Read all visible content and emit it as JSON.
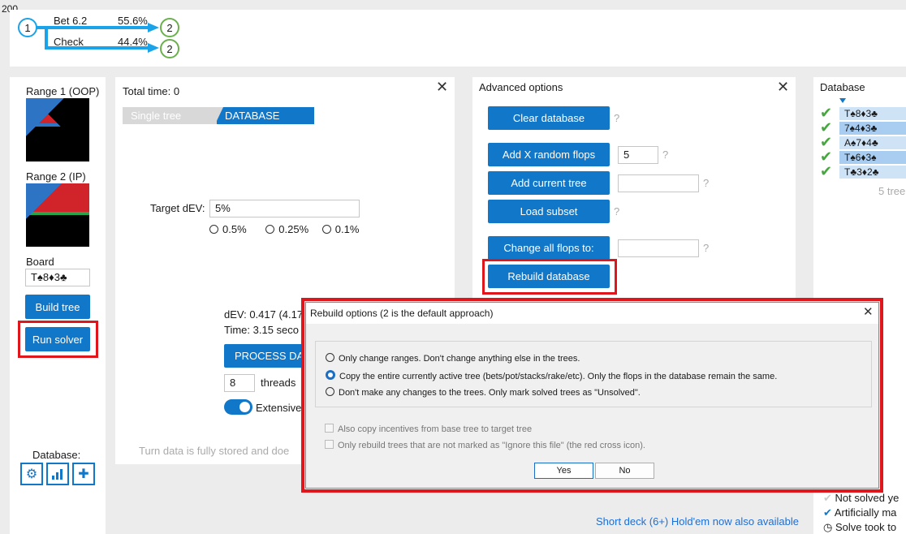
{
  "corner_label": "200",
  "tree": {
    "root_node": "1",
    "branches": [
      {
        "action": "Bet 6.2",
        "freq": "55.6%",
        "node": "2"
      },
      {
        "action": "Check",
        "freq": "44.4%",
        "node": "2"
      }
    ]
  },
  "left_panel": {
    "range1_label": "Range 1 (OOP)",
    "range2_label": "Range 2 (IP)",
    "board_label": "Board",
    "board_value": "T♠8♦3♣",
    "build_tree": "Build tree",
    "run_solver": "Run solver",
    "database_label": "Database:",
    "icons": [
      "gear-icon",
      "bar-chart-icon",
      "plus-icon"
    ]
  },
  "middle_panel": {
    "total_time": "Total time: 0",
    "tabs": [
      "Single tree",
      "DATABASE"
    ],
    "target_dev_label": "Target dEV:",
    "target_dev_value": "5%",
    "radio_options": [
      "0.5%",
      "0.25%",
      "0.1%"
    ],
    "dev_result": "dEV: 0.417 (4.17",
    "time_result": "Time: 3.15 seco",
    "process_button": "PROCESS DAT",
    "threads_value": "8",
    "threads_label": "threads",
    "extensive_label": "Extensive",
    "footer_note": "Turn data is fully stored and doe"
  },
  "advanced": {
    "title": "Advanced options",
    "clear_db": "Clear database",
    "add_random": "Add X random flops",
    "random_count": "5",
    "add_current": "Add current tree",
    "load_subset": "Load subset",
    "change_flops": "Change all flops to:",
    "rebuild_db": "Rebuild database",
    "qmark": "?"
  },
  "database_panel": {
    "title": "Database",
    "rows": [
      "T♠8♦3♣",
      "7♠4♦3♣",
      "A♠7♦4♣",
      "T♠6♦3♠",
      "T♣3♦2♣"
    ],
    "tree_count": "5 tree",
    "legend": [
      "Not solved ye",
      "Artificially ma",
      "Solve took to"
    ]
  },
  "bottom_link": "Short deck (6+) Hold'em now also available",
  "dialog": {
    "title": "Rebuild options (2 is the default approach)",
    "options": [
      "Only change ranges. Don't change anything else in the trees.",
      "Copy the entire currently active tree (bets/pot/stacks/rake/etc). Only the flops in the database remain the same.",
      "Don't make any changes to the trees. Only mark solved trees as \"Unsolved\"."
    ],
    "selected_index": 1,
    "checkboxes": [
      "Also copy incentives from base tree to target tree",
      "Only rebuild trees that are not marked as \"Ignore this file\" (the red cross icon)."
    ],
    "yes": "Yes",
    "no": "No"
  },
  "colors": {
    "accent": "#1177c9",
    "highlight": "#e0161d",
    "tree_line": "#1aa3e8",
    "node_ok": "#6ab04c"
  }
}
